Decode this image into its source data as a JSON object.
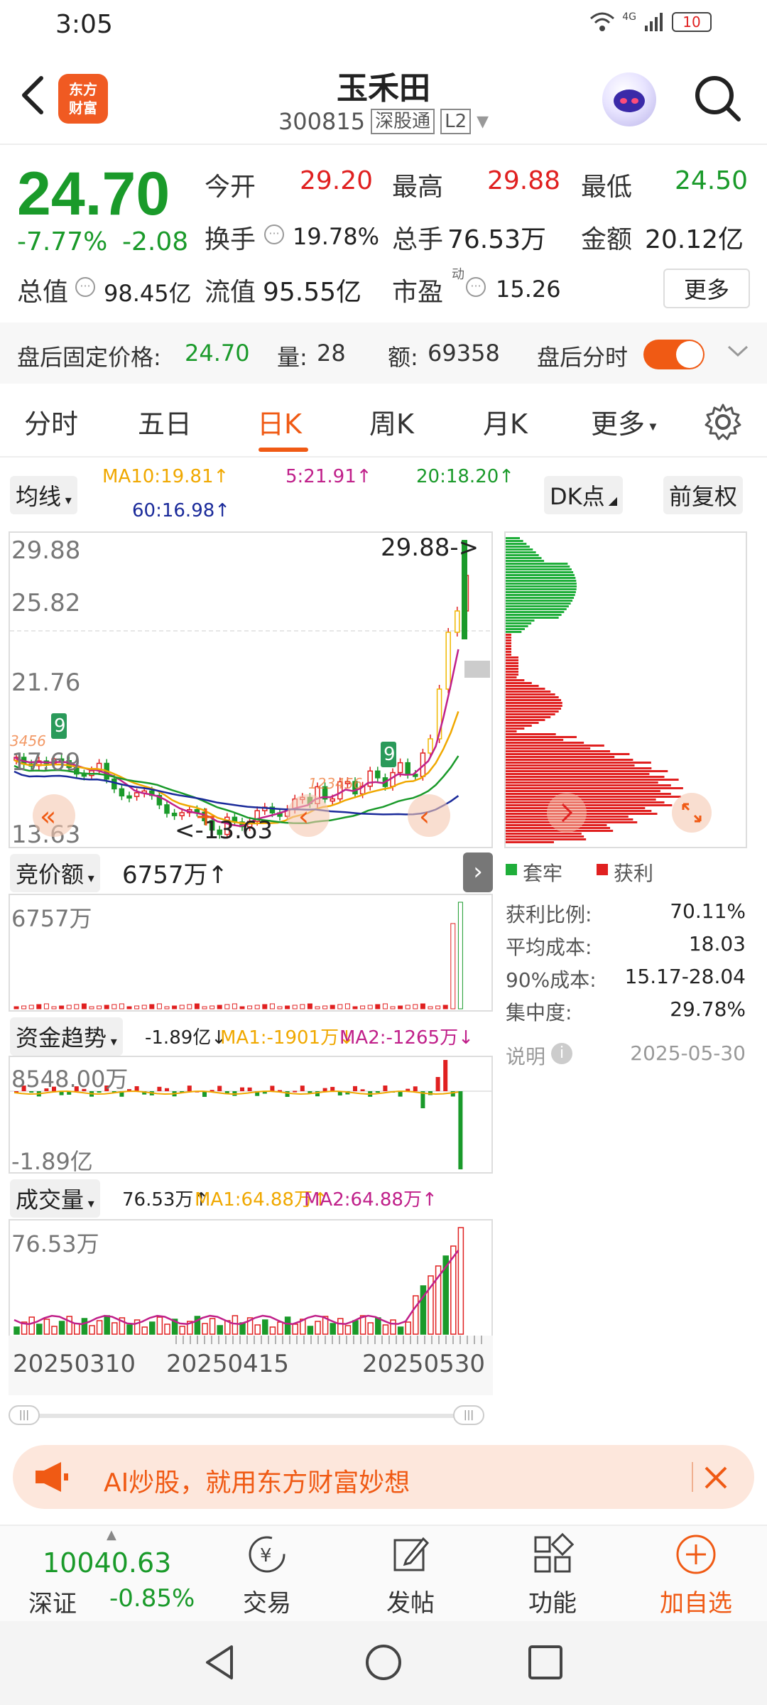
{
  "status": {
    "time": "3:05",
    "network": "4G",
    "battery": "10"
  },
  "header": {
    "brand_line1": "东方",
    "brand_line2": "财富",
    "stock_name": "玉禾田",
    "stock_code": "300815",
    "tag_connect": "深股通",
    "tag_level": "L2"
  },
  "quote": {
    "price": "24.70",
    "pct": "-7.77%",
    "chg": "-2.08",
    "open_label": "今开",
    "open": "29.20",
    "high_label": "最高",
    "high": "29.88",
    "low_label": "最低",
    "low": "24.50",
    "turnover_label": "换手",
    "turnover": "19.78%",
    "volume_label": "总手",
    "volume": "76.53万",
    "amount_label": "金额",
    "amount": "20.12亿",
    "mktcap_label": "总值",
    "mktcap": "98.45亿",
    "float_label": "流值",
    "float": "95.55亿",
    "pe_label": "市盈",
    "pe_sup": "动",
    "pe": "15.26",
    "more": "更多"
  },
  "after_hours": {
    "price_label": "盘后固定价格:",
    "price": "24.70",
    "vol_label": "量:",
    "vol": "28",
    "amt_label": "额:",
    "amt": "69358",
    "toggle_label": "盘后分时"
  },
  "tabs": [
    {
      "label": "分时"
    },
    {
      "label": "五日"
    },
    {
      "label": "日K"
    },
    {
      "label": "周K"
    },
    {
      "label": "月K"
    },
    {
      "label": "更多"
    }
  ],
  "ma_row": {
    "selector": "均线",
    "ma10": "MA10:19.81↑",
    "ma5": "5:21.91↑",
    "ma20": "20:18.20↑",
    "ma60": "60:16.98↑",
    "dk": "DK点",
    "adj": "前复权"
  },
  "main_chart": {
    "y_labels": [
      "29.88",
      "25.82",
      "21.76",
      "17.69",
      "13.63"
    ],
    "max_marker": "29.88->",
    "min_marker": "<-13.63",
    "seq_mark": "9"
  },
  "sub1": {
    "selector": "竞价额",
    "value": "6757万↑",
    "max_label": "6757万"
  },
  "sub2": {
    "selector": "资金趋势",
    "value": "-1.89亿↓",
    "ma1": "MA1:-1901万↓",
    "ma2": "MA2:-1265万↓",
    "max_label": "8548.00万",
    "min_label": "-1.89亿"
  },
  "sub3": {
    "selector": "成交量",
    "value": "76.53万↑",
    "ma1": "MA1:64.88万↑",
    "ma2": "MA2:64.88万↑",
    "max_label": "76.53万"
  },
  "dates": [
    "20250310",
    "20250415",
    "20250530"
  ],
  "chip": {
    "legend_trapped": "套牢",
    "legend_profit": "获利",
    "rows": [
      {
        "label": "获利比例:",
        "value": "70.11%"
      },
      {
        "label": "平均成本:",
        "value": "18.03"
      },
      {
        "label": "90%成本:",
        "value": "15.17-28.04"
      },
      {
        "label": "集中度:",
        "value": "29.78%"
      }
    ],
    "note_label": "说明",
    "date": "2025-05-30"
  },
  "banner": {
    "text": "AI炒股，就用东方财富妙想"
  },
  "bottom_nav": {
    "index_value": "10040.63",
    "index_name": "深证",
    "index_pct": "-0.85%",
    "trade": "交易",
    "post": "发帖",
    "func": "功能",
    "add": "加自选"
  },
  "colors": {
    "up": "#e02020",
    "down": "#1a9a2a",
    "accent": "#f05a14",
    "ma10": "#f0a800",
    "ma5": "#c0208a",
    "ma20": "#1a9a2a",
    "ma60": "#1a2a9a"
  }
}
